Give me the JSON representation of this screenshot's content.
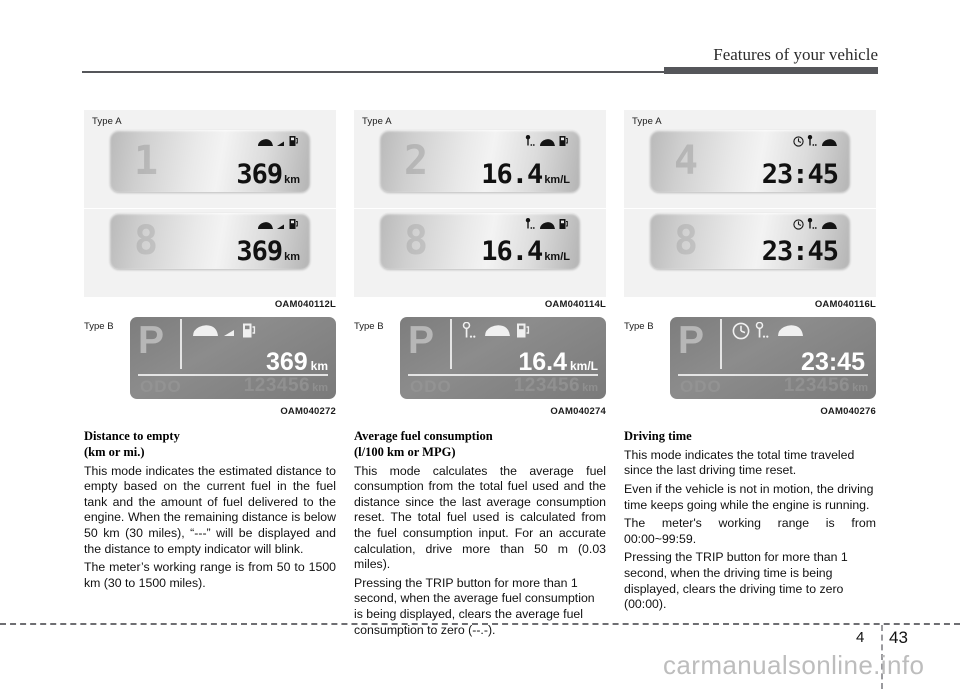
{
  "header": {
    "title": "Features of your vehicle"
  },
  "footer": {
    "chapter": "4",
    "page": "43",
    "watermark": "carmanualsonline.info"
  },
  "labels": {
    "type_a": "Type A",
    "type_b": "Type B"
  },
  "columns": [
    {
      "id": "distance-to-empty",
      "figure_code_a": "OAM040112L",
      "figure_code_b": "OAM040272",
      "type_a": {
        "ghost_digit_top": "1",
        "ghost_digit_bottom": "8",
        "value": "369",
        "unit": "km",
        "icons": [
          "car-icon",
          "arrow-icon",
          "fuel-pump-icon"
        ]
      },
      "type_b": {
        "gear": "P",
        "value": "369",
        "unit": "km",
        "odo_label": "ODO",
        "odo_value": "123456",
        "odo_unit": "km",
        "icons": [
          "car-icon",
          "arrow-icon",
          "fuel-pump-icon"
        ]
      },
      "heading_line1": "Distance to empty",
      "heading_line2": "(km or mi.)",
      "paragraphs": [
        "This mode indicates the estimated distance to empty based on the current fuel in the fuel tank and the amount of fuel delivered to the engine. When the remaining distance is below 50 km (30 miles), “---” will be displayed and the distance to empty indicator will blink.",
        "The meter’s working range is from 50 to 1500 km (30 to 1500 miles)."
      ]
    },
    {
      "id": "average-fuel-consumption",
      "figure_code_a": "OAM040114L",
      "figure_code_b": "OAM040274",
      "type_a": {
        "ghost_digit_top": "2",
        "ghost_digit_bottom": "8",
        "value": "16.4",
        "unit": "km/L",
        "icons": [
          "distance-pin-icon",
          "car-icon",
          "fuel-pump-icon"
        ]
      },
      "type_b": {
        "gear": "P",
        "value": "16.4",
        "unit": "km/L",
        "odo_label": "ODO",
        "odo_value": "123456",
        "odo_unit": "km",
        "icons": [
          "distance-pin-icon",
          "car-icon",
          "fuel-pump-icon"
        ]
      },
      "heading_line1": "Average fuel consumption",
      "heading_line2": "(l/100 km or MPG)",
      "paragraphs": [
        "This mode calculates the average fuel consumption from the total fuel used and the distance since the last average consumption reset. The total fuel used is calculated from the fuel consumption input. For an accurate calculation, drive more than 50 m (0.03 miles).",
        "Pressing the TRIP button for more than 1 second, when the average fuel consumption is being displayed, clears the average fuel consumption to zero (--.-)."
      ]
    },
    {
      "id": "driving-time",
      "figure_code_a": "OAM040116L",
      "figure_code_b": "OAM040276",
      "type_a": {
        "ghost_digit_top": "4",
        "ghost_digit_bottom": "8",
        "value": "23:45",
        "unit": "",
        "icons": [
          "clock-icon",
          "distance-pin-icon",
          "car-icon"
        ]
      },
      "type_b": {
        "gear": "P",
        "value": "23:45",
        "unit": "",
        "odo_label": "ODO",
        "odo_value": "123456",
        "odo_unit": "km",
        "icons": [
          "clock-icon",
          "distance-pin-icon",
          "car-icon"
        ]
      },
      "heading_line1": "Driving time",
      "heading_line2": "",
      "paragraphs": [
        "This mode indicates the total time traveled since the last driving time reset.",
        "Even if the vehicle is not in motion, the driving time keeps going while the engine is running.",
        "The meter's working range is from 00:00~99:59.",
        "Pressing the TRIP button for more than 1 second, when the driving time is being displayed, clears the driving time to zero (00:00)."
      ]
    }
  ]
}
